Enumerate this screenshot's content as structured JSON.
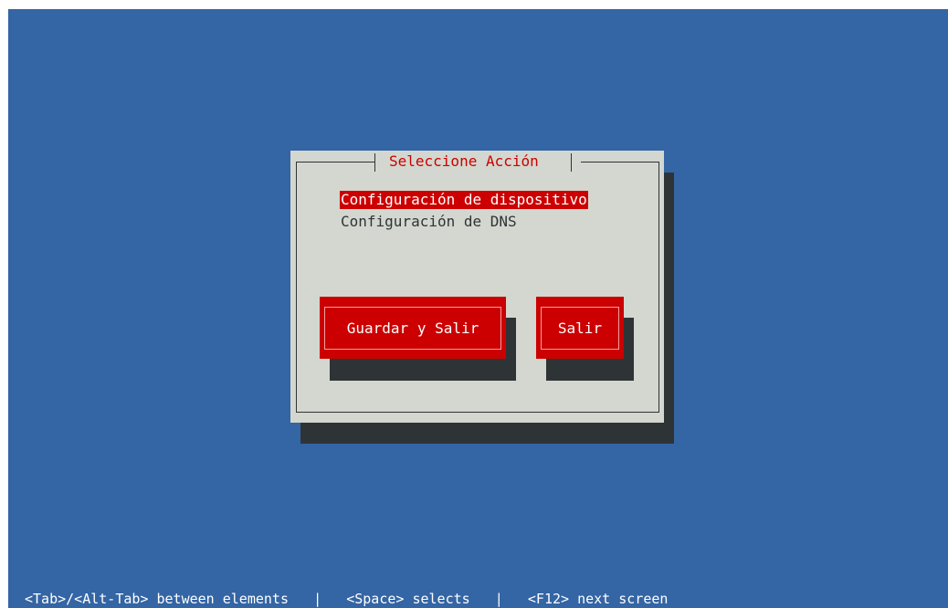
{
  "dialog": {
    "title": "Seleccione Acción",
    "menu_items": [
      {
        "label": "Configuración de dispositivo",
        "selected": true
      },
      {
        "label": "Configuración de DNS",
        "selected": false
      }
    ],
    "buttons": {
      "save_exit_label": "Guardar y Salir",
      "exit_label": "Salir"
    }
  },
  "footer": {
    "hint_tab": "<Tab>/<Alt-Tab> between elements",
    "separator": "|",
    "hint_space": "<Space> selects",
    "hint_f12": "<F12> next screen"
  },
  "colors": {
    "background": "#3465a4",
    "dialog": "#d3d7cf",
    "accent": "#cc0000",
    "shadow": "#2e3436"
  }
}
